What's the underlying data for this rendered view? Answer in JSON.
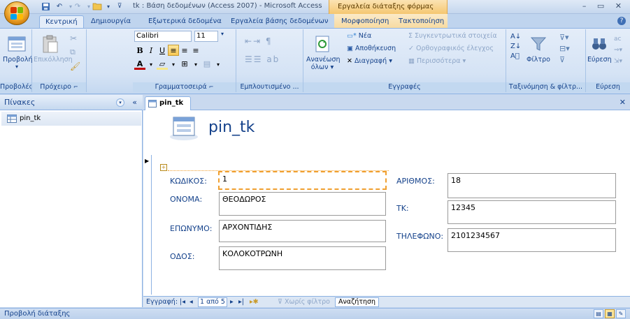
{
  "window": {
    "title": "tk : Βάση δεδομένων (Access 2007) - Microsoft Access",
    "context_title": "Εργαλεία διάταξης φόρμας",
    "controls": "– ▭ ✕"
  },
  "tabs": {
    "home": "Κεντρική",
    "create": "Δημιουργία",
    "external": "Εξωτερικά δεδομένα",
    "dbtools": "Εργαλεία βάσης δεδομένων",
    "format": "Μορφοποίηση",
    "arrange": "Τακτοποίηση"
  },
  "ribbon": {
    "view_label": "Προβολή",
    "paste_label": "Επικόλληση",
    "font_name": "Calibri",
    "font_size": "11",
    "refresh_label_1": "Ανανέωση",
    "refresh_label_2": "όλων ▾",
    "new_label": "Νέα",
    "save_label": "Αποθήκευση",
    "delete_label": "Διαγραφή ▾",
    "totals_label": "Συγκεντρωτικά στοιχεία",
    "spelling_label": "Ορθογραφικός έλεγχος",
    "more_label": "Περισσότερα ▾",
    "filter_label": "Φίλτρο",
    "find_label": "Εύρεση",
    "groups": {
      "views": "Προβολές",
      "clipboard": "Πρόχειρο",
      "font": "Γραμματοσειρά",
      "rich_text": "Εμπλουτισμένο ...",
      "records": "Εγγραφές",
      "sort_filter": "Ταξινόμηση & φίλτρ...",
      "find": "Εύρεση"
    }
  },
  "nav": {
    "header": "Πίνακες",
    "item": "pin_tk"
  },
  "doc": {
    "tab": "pin_tk",
    "form_title": "pin_tk"
  },
  "fields": {
    "code_label": "ΚΩΔΙΚΟΣ:",
    "code_value": "1",
    "name_label": "ΟΝΟΜΑ:",
    "name_value": "ΘΕΟΔΩΡΟΣ",
    "surname_label": "ΕΠΩΝΥΜΟ:",
    "surname_value": "ΑΡΧΟΝΤΙΔΗΣ",
    "street_label": "ΟΔΟΣ:",
    "street_value": "ΚΟΛΟΚΟΤΡΩΝΗ",
    "number_label": "ΑΡΙΘΜΟΣ:",
    "number_value": "18",
    "zip_label": "ΤΚ:",
    "zip_value": "12345",
    "phone_label": "ΤΗΛΕΦΩΝΟ:",
    "phone_value": "2101234567"
  },
  "recnav": {
    "record_label": "Εγγραφή:",
    "position": "1 από 5",
    "no_filter": "Χωρίς φίλτρο",
    "search": "Αναζήτηση"
  },
  "status": {
    "text": "Προβολή διάταξης"
  },
  "colors": {
    "ribbon_blue": "#15428b",
    "focus_orange": "#f0a030"
  }
}
